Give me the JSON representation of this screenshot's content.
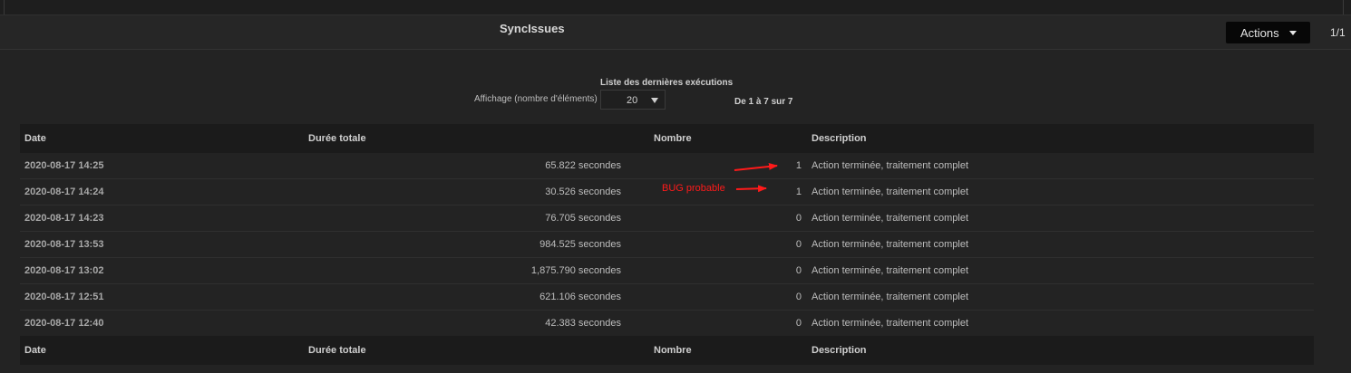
{
  "header": {
    "title": "SyncIssues",
    "actions_label": "Actions",
    "pager": "1/1"
  },
  "list": {
    "title": "Liste des dernières exécutions",
    "display_label": "Affichage (nombre d'éléments)",
    "page_size": "20",
    "range_text": "De 1 à 7 sur 7"
  },
  "table": {
    "columns": [
      "Date",
      "Durée totale",
      "Nombre",
      "Description"
    ],
    "rows": [
      {
        "date": "2020-08-17 14:25",
        "duration": "65.822 secondes",
        "count": "1",
        "description": "Action terminée, traitement complet"
      },
      {
        "date": "2020-08-17 14:24",
        "duration": "30.526 secondes",
        "count": "1",
        "description": "Action terminée, traitement complet"
      },
      {
        "date": "2020-08-17 14:23",
        "duration": "76.705 secondes",
        "count": "0",
        "description": "Action terminée, traitement complet"
      },
      {
        "date": "2020-08-17 13:53",
        "duration": "984.525 secondes",
        "count": "0",
        "description": "Action terminée, traitement complet"
      },
      {
        "date": "2020-08-17 13:02",
        "duration": "1,875.790 secondes",
        "count": "0",
        "description": "Action terminée, traitement complet"
      },
      {
        "date": "2020-08-17 12:51",
        "duration": "621.106 secondes",
        "count": "0",
        "description": "Action terminée, traitement complet"
      },
      {
        "date": "2020-08-17 12:40",
        "duration": "42.383 secondes",
        "count": "0",
        "description": "Action terminée, traitement complet"
      }
    ]
  },
  "annotation": {
    "label": "BUG probable",
    "color": "#ff1a1a"
  }
}
